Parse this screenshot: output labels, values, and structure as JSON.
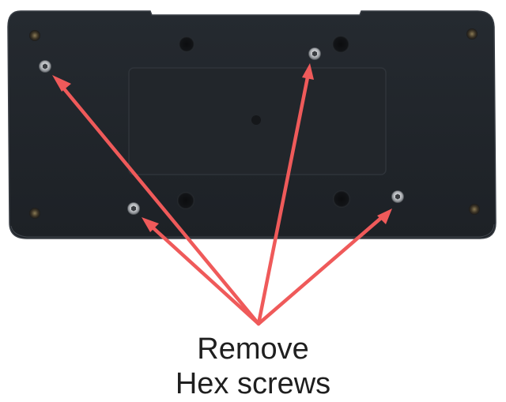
{
  "caption": {
    "line1": "Remove",
    "line2": "Hex screws"
  },
  "colors": {
    "background": "#ffffff",
    "device_body": "#23272d",
    "device_edge": "#30343a",
    "arrow": "#ef5a5a",
    "screw_metal": "#c9ccd0",
    "caption_text": "#1f1f1f"
  },
  "icons": [
    "hex-screw-icon",
    "arrow-icon"
  ]
}
